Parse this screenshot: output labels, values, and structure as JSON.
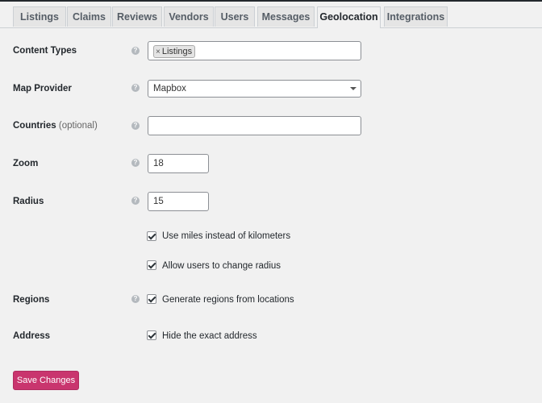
{
  "tabs": [
    {
      "label": "Listings"
    },
    {
      "label": "Claims"
    },
    {
      "label": "Reviews"
    },
    {
      "label": "Vendors"
    },
    {
      "label": "Users"
    },
    {
      "label": "Messages"
    },
    {
      "label": "Geolocation",
      "active": true
    },
    {
      "label": "Integrations"
    }
  ],
  "help_glyph": "?",
  "fields": {
    "content_types": {
      "label": "Content Types",
      "tag_remove": "×",
      "tag": "Listings"
    },
    "map_provider": {
      "label": "Map Provider",
      "value": "Mapbox"
    },
    "countries": {
      "label": "Countries",
      "optional": "(optional)",
      "value": ""
    },
    "zoom": {
      "label": "Zoom",
      "value": "18"
    },
    "radius": {
      "label": "Radius",
      "value": "15"
    },
    "use_miles": {
      "label": "Use miles instead of kilometers",
      "checked": true
    },
    "allow_radius": {
      "label": "Allow users to change radius",
      "checked": true
    },
    "regions": {
      "label": "Regions",
      "option": "Generate regions from locations",
      "checked": true
    },
    "address": {
      "label": "Address",
      "option": "Hide the exact address",
      "checked": true
    }
  },
  "save_button": "Save Changes",
  "colors": {
    "accent": "#c9356e",
    "background": "#f1f1f1",
    "tab_bg": "#e5e5e5"
  }
}
